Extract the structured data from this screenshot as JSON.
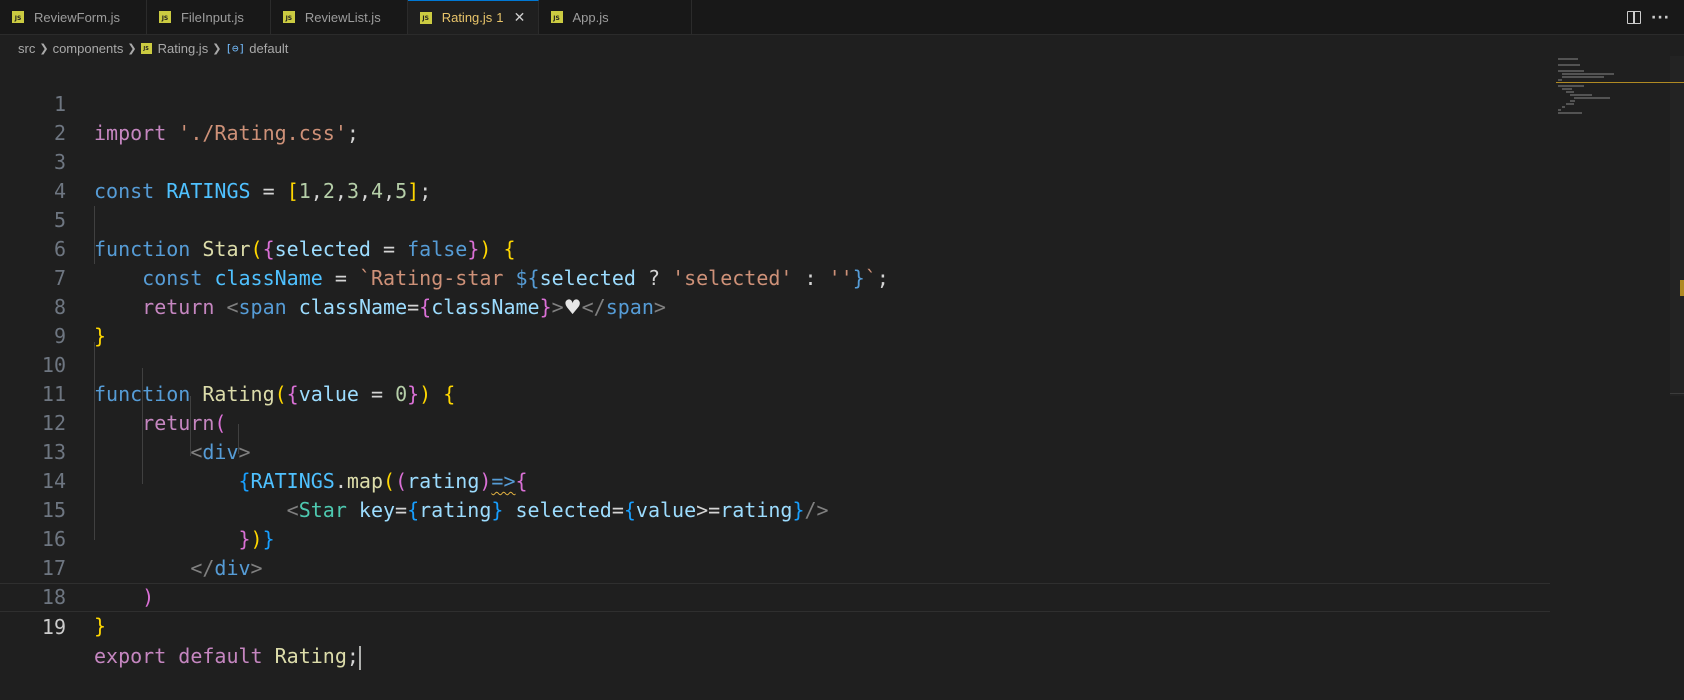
{
  "tabs": [
    {
      "label": "ReviewForm.js",
      "icon": "js-file-icon",
      "active": false
    },
    {
      "label": "FileInput.js",
      "icon": "js-file-icon",
      "active": false
    },
    {
      "label": "ReviewList.js",
      "icon": "js-file-icon",
      "active": false
    },
    {
      "label": "Rating.js",
      "badge": "1",
      "icon": "js-file-icon",
      "active": true
    },
    {
      "label": "App.js",
      "icon": "js-file-icon",
      "active": false
    }
  ],
  "tab_icon_text": "JS",
  "breadcrumb": {
    "items": [
      "src",
      "components",
      "Rating.js",
      "default"
    ]
  },
  "editor": {
    "current_line": 19,
    "line_numbers": [
      "1",
      "2",
      "3",
      "4",
      "5",
      "6",
      "7",
      "8",
      "9",
      "10",
      "11",
      "12",
      "13",
      "14",
      "15",
      "16",
      "17",
      "18",
      "19"
    ]
  },
  "colors": {
    "active_tab_text": "#e8c46a",
    "accent_blue": "#0078d4",
    "js_icon": "#cbcb41",
    "editor_bg": "#1f1f1f"
  }
}
